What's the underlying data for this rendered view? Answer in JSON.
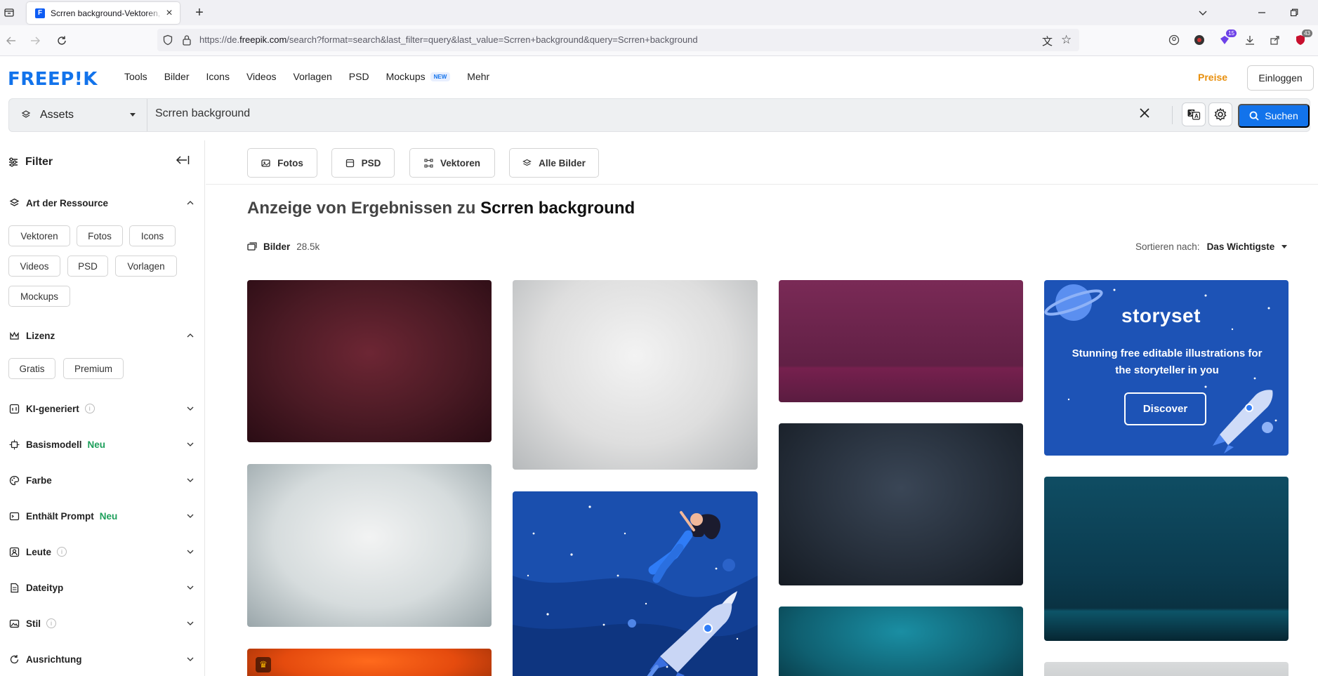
{
  "browser": {
    "tab_title": "Scrren background-Vektoren, - Freepik",
    "favicon_letter": "F",
    "url_prefix": "https://de.",
    "url_domain": "freepik.com",
    "url_rest": "/search?format=search&last_filter=query&last_value=Scrren+background&query=Scrren+background",
    "ext_badge_count": "15",
    "ext_badge_count2": "43"
  },
  "header": {
    "logo": "FREEP!K",
    "nav": [
      "Tools",
      "Bilder",
      "Icons",
      "Videos",
      "Vorlagen",
      "PSD",
      "Mockups",
      "Mehr"
    ],
    "new_tag": "NEW",
    "preise": "Preise",
    "login": "Einloggen"
  },
  "search": {
    "category": "Assets",
    "query": "Scrren background",
    "button": "Suchen"
  },
  "sidebar": {
    "title": "Filter",
    "resource_section": "Art der Ressource",
    "resource_chips": [
      "Vektoren",
      "Fotos",
      "Icons",
      "Videos",
      "PSD",
      "Vorlagen",
      "Mockups"
    ],
    "license_section": "Lizenz",
    "license_chips": [
      "Gratis",
      "Premium"
    ],
    "sections": [
      {
        "label": "KI-generiert",
        "tag": "",
        "info": true
      },
      {
        "label": "Basismodell",
        "tag": "Neu",
        "info": false
      },
      {
        "label": "Farbe",
        "tag": "",
        "info": false
      },
      {
        "label": "Enthält Prompt",
        "tag": "Neu",
        "info": false
      },
      {
        "label": "Leute",
        "tag": "",
        "info": true
      },
      {
        "label": "Dateityp",
        "tag": "",
        "info": false
      },
      {
        "label": "Stil",
        "tag": "",
        "info": true
      },
      {
        "label": "Ausrichtung",
        "tag": "",
        "info": false
      }
    ]
  },
  "content": {
    "type_tabs": [
      "Fotos",
      "PSD",
      "Vektoren",
      "Alle Bilder"
    ],
    "heading_prefix": "Anzeige von Ergebnissen zu",
    "heading_query": "Scrren background",
    "count_label": "Bilder",
    "count_value": "28.5k",
    "sort_label": "Sortieren nach:",
    "sort_value": "Das Wichtigste"
  },
  "ad": {
    "brand": "storyset",
    "text": "Stunning free editable illustrations for the storyteller in you",
    "button": "Discover"
  },
  "colors": {
    "brand": "#1273eb",
    "preise": "#e88f0d",
    "neu": "#1d9f5b",
    "ad_bg": "#1d53b6"
  }
}
